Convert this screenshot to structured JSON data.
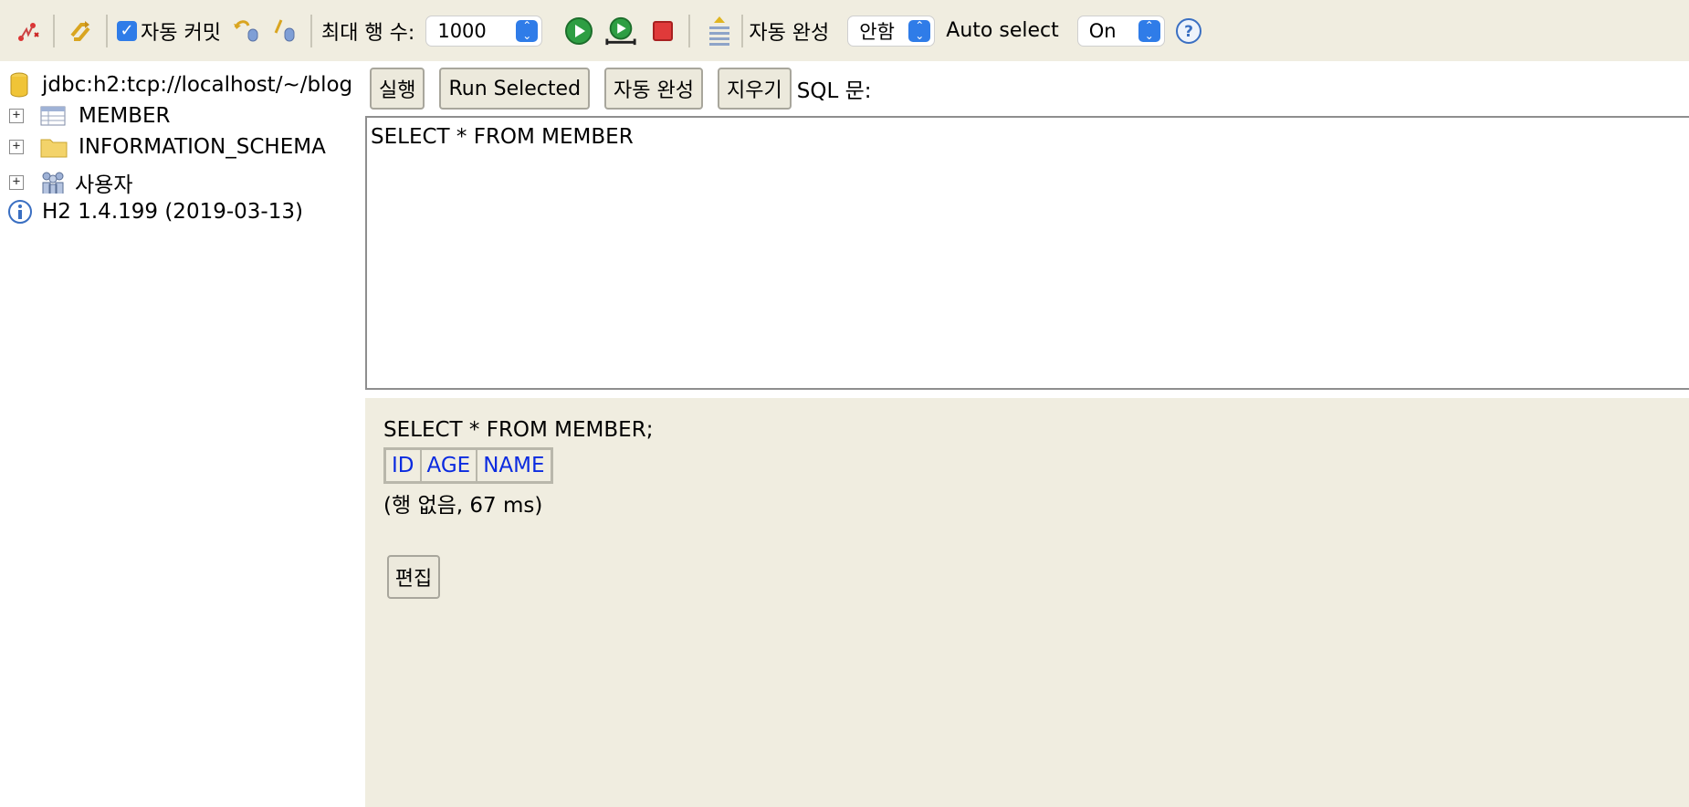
{
  "toolbar": {
    "autocommit_label": "자동 커밋",
    "autocommit_checked": true,
    "max_rows_label": "최대 행 수:",
    "max_rows_value": "1000",
    "autocomplete_label": "자동 완성",
    "autocomplete_value": "안함",
    "auto_select_label": "Auto select",
    "auto_select_value": "On",
    "accent_color": "#2f7ce8"
  },
  "tree": {
    "connection": "jdbc:h2:tcp://localhost/~/blog",
    "items": [
      {
        "label": "MEMBER",
        "icon": "table-icon"
      },
      {
        "label": "INFORMATION_SCHEMA",
        "icon": "folder-icon"
      },
      {
        "label": "사용자",
        "icon": "users-icon"
      }
    ],
    "version": "H2 1.4.199 (2019-03-13)"
  },
  "sql_toolbar": {
    "run": "실행",
    "run_selected": "Run Selected",
    "autocomplete": "자동 완성",
    "clear": "지우기",
    "sql_label": "SQL 문:"
  },
  "editor": {
    "text": "SELECT * FROM MEMBER"
  },
  "result": {
    "query": "SELECT * FROM MEMBER;",
    "columns": [
      "ID",
      "AGE",
      "NAME"
    ],
    "info": "(행 없음, 67 ms)",
    "edit_button": "편집"
  }
}
